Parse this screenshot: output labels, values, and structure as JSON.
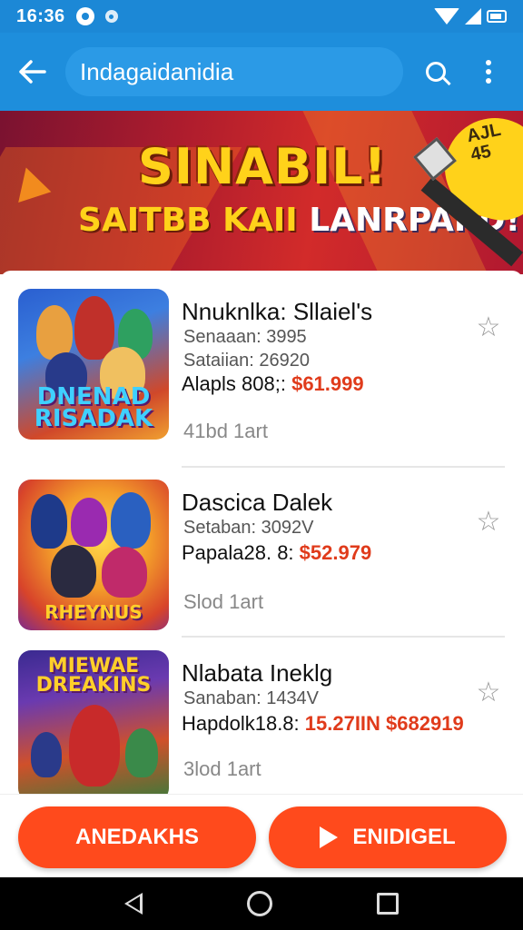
{
  "status_bar": {
    "time": "16:36",
    "icons": [
      "notification-dot-icon",
      "notification-dot-icon",
      "wifi-icon",
      "signal-icon",
      "battery-icon"
    ]
  },
  "app_bar": {
    "search_value": "Indagaidanidia",
    "icons": [
      "back-arrow-icon",
      "search-icon",
      "more-vert-icon"
    ]
  },
  "banner": {
    "line1": "SINABIL!",
    "line2a": "SAITBB KAII ",
    "line2b": "LANRPAIID!",
    "badge_text": "AJL 45",
    "accent": "#ffd21a"
  },
  "items": [
    {
      "name": "Nnuknlka: Sllaiel's",
      "meta1": "Senaaan: 3995",
      "meta2": "Sataiian: 26920",
      "price_label": "Alapls 808;: ",
      "price": "$61.999",
      "footnote": "41bd 1art",
      "thumb_text": "DNENAD\nRISADAK"
    },
    {
      "name": "Dascica Dalek",
      "meta1": "Setaban: 3092V",
      "price_label": "Papala28. 8: ",
      "price": "$52.979",
      "footnote": "Slod 1art",
      "thumb_text": "RHEYNUS"
    },
    {
      "name": "Nlabata Ineklg",
      "meta1": "Sanaban: 1434V",
      "price_label": "Hapdolk18.8: ",
      "price": "15.27IIN $682919",
      "footnote": "3lod 1art",
      "thumb_text": "MIEWAE\nDREAKINS"
    }
  ],
  "actions": {
    "left_label": "ANEDAKHS",
    "right_label": "ENIDIGEL",
    "color": "#ff4a1c"
  },
  "nav": {
    "icons": [
      "nav-back-icon",
      "nav-home-icon",
      "nav-recents-icon"
    ]
  }
}
